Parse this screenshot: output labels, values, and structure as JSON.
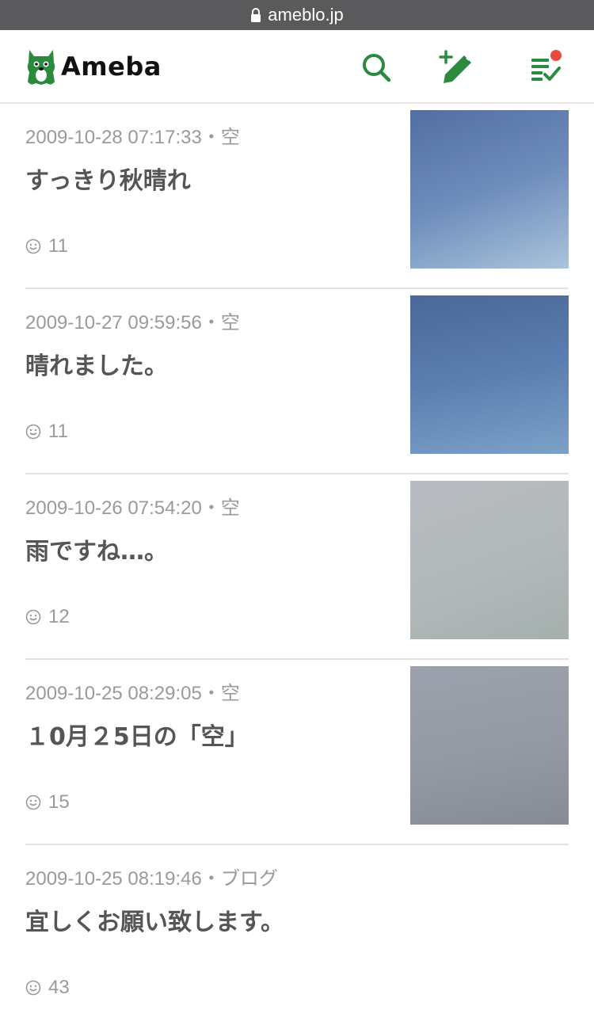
{
  "browser": {
    "url": "ameblo.jp"
  },
  "header": {
    "logo_text": "Ameba",
    "icons": [
      "search-icon",
      "write-post-icon",
      "feed-list-icon"
    ],
    "brand_color": "#2a8a3e",
    "notification_color": "#e84b3c"
  },
  "entries": [
    {
      "date": "2009-10-28 07:17:33・空",
      "title": "すっきり秋晴れ",
      "likes": "11",
      "thumb_colors": [
        "#5b77a8",
        "#8fb0cf"
      ]
    },
    {
      "date": "2009-10-27 09:59:56・空",
      "title": "晴れました。",
      "likes": "11",
      "thumb_colors": [
        "#4d6c9f",
        "#7a9ec7"
      ]
    },
    {
      "date": "2009-10-26 07:54:20・空",
      "title": "雨ですね…。",
      "likes": "12",
      "thumb_colors": [
        "#b6bbbf",
        "#a6b1b0"
      ]
    },
    {
      "date": "2009-10-25 08:29:05・空",
      "title": "１0月２5日の「空」",
      "likes": "15",
      "thumb_colors": [
        "#9a9fab",
        "#8a8e99"
      ]
    },
    {
      "date": "2009-10-25 08:19:46・ブログ",
      "title": "宜しくお願い致します。",
      "likes": "43"
    }
  ]
}
